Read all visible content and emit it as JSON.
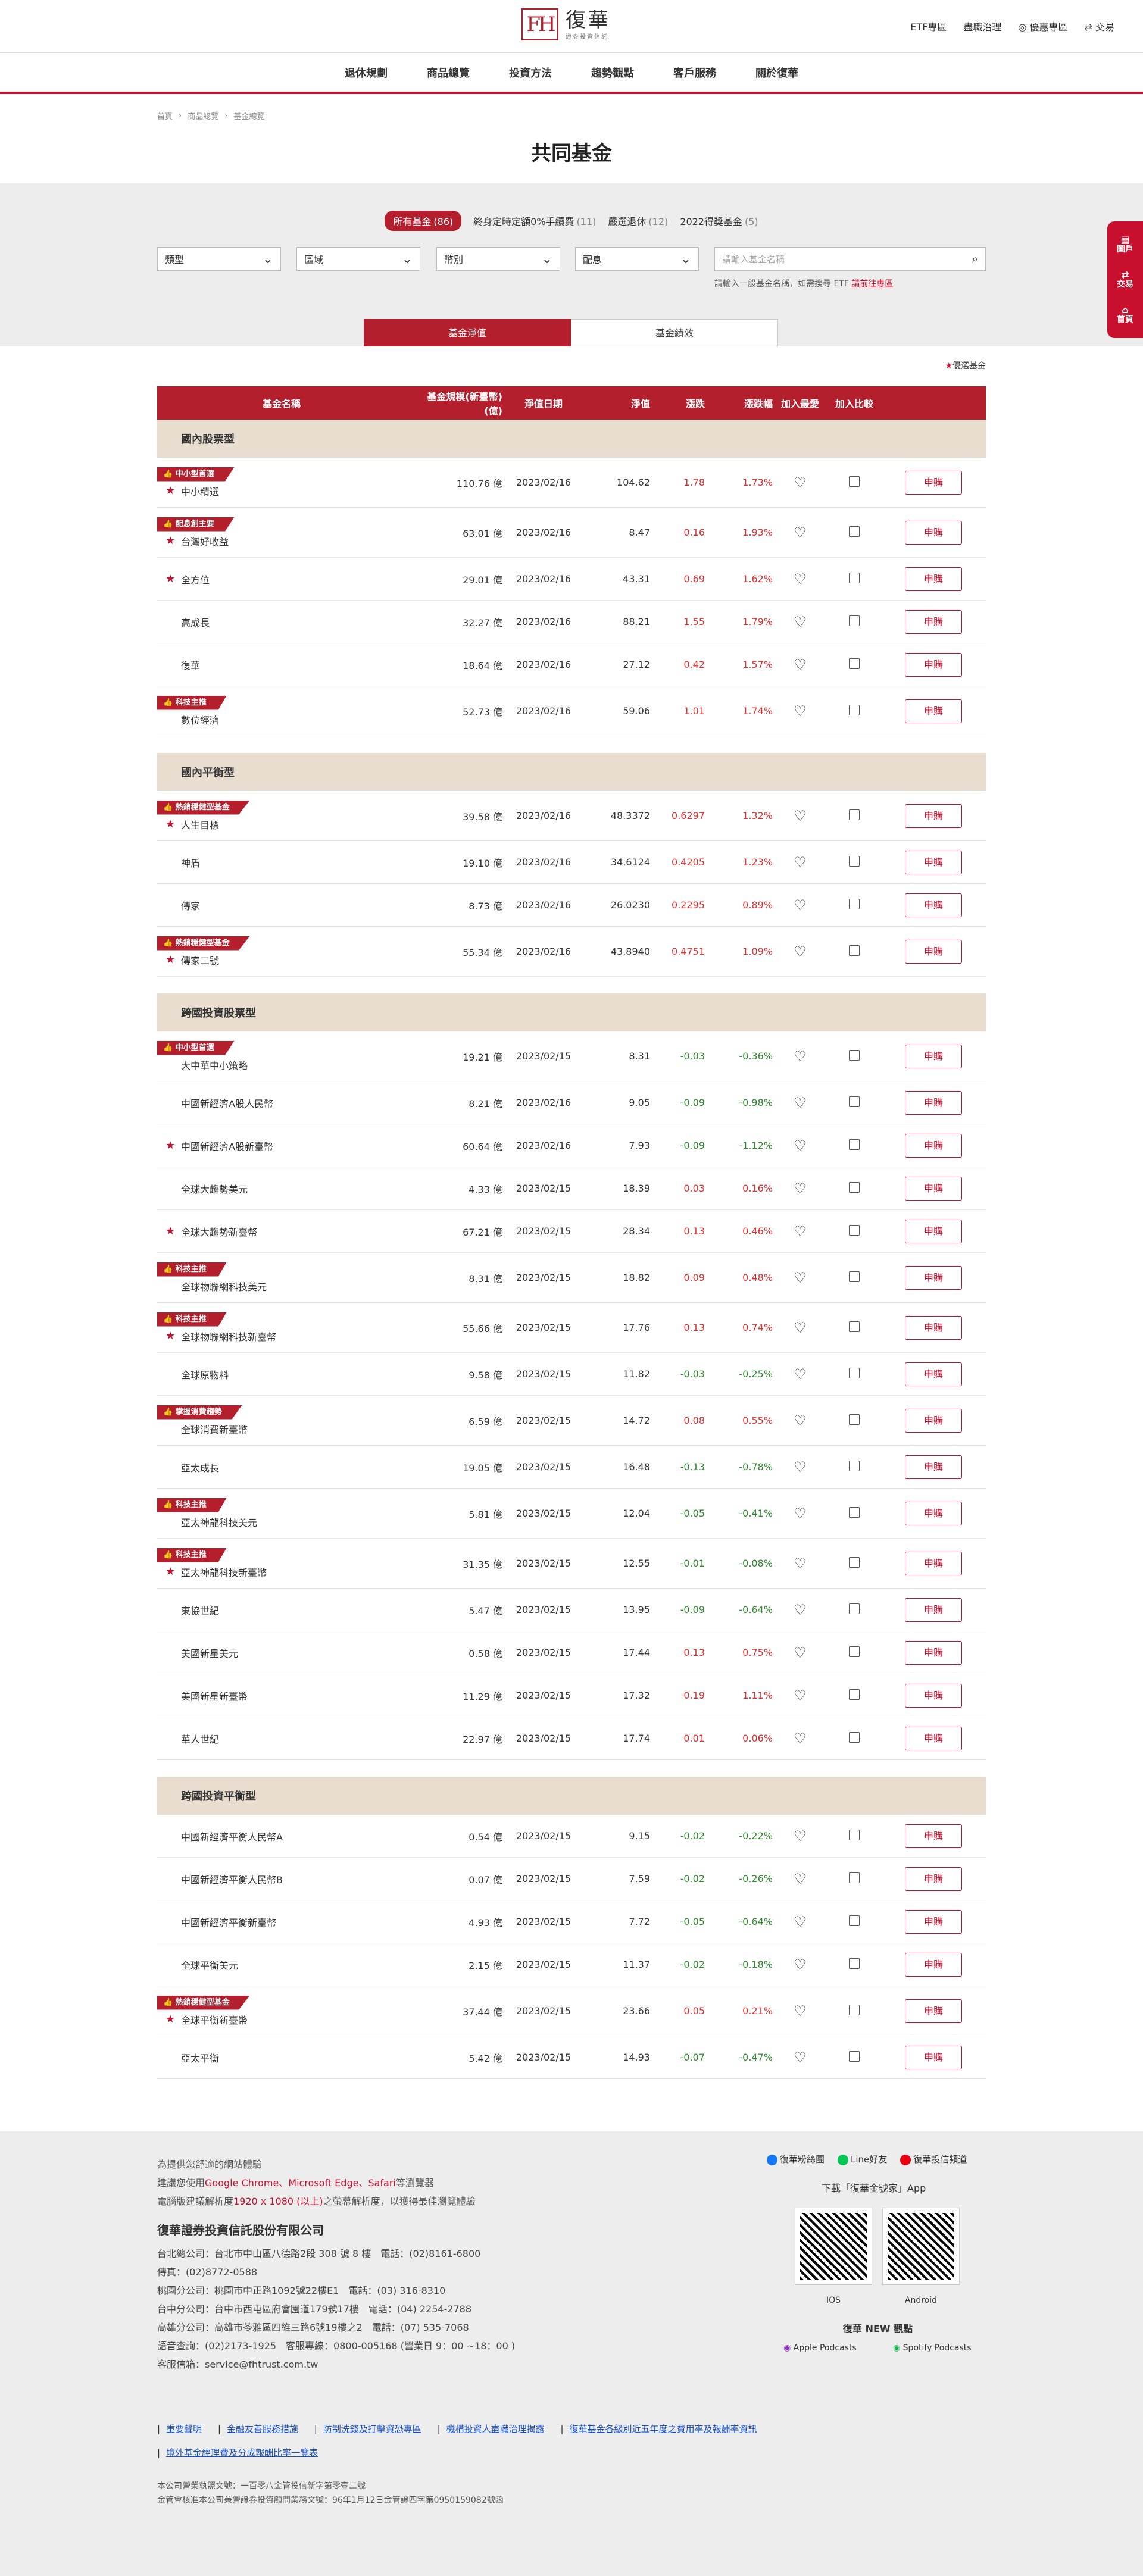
{
  "header": {
    "logo_mark": "FH",
    "logo_cn": "復華",
    "logo_sub": "證券投資信託",
    "links": [
      "ETF專區",
      "盡職治理",
      "優惠專區",
      "交易"
    ]
  },
  "nav": [
    "退休規劃",
    "商品總覽",
    "投資方法",
    "趨勢觀點",
    "客戶服務",
    "關於復華"
  ],
  "breadcrumb": [
    "首頁",
    "商品總覽",
    "基金總覽"
  ],
  "title": "共同基金",
  "filter_tabs": [
    {
      "label": "所有基金",
      "count": "(86)"
    },
    {
      "label": "終身定時定額0%手續費",
      "count": "(11)"
    },
    {
      "label": "嚴選退休",
      "count": "(12)"
    },
    {
      "label": "2022得獎基金",
      "count": "(5)"
    }
  ],
  "selects": [
    "類型",
    "區域",
    "幣別",
    "配息"
  ],
  "search": {
    "placeholder": "請輸入基金名稱",
    "hint": "請輸入一般基金名稱，如需搜尋 ETF",
    "hint_link": "請前往專區"
  },
  "segments": [
    "基金淨值",
    "基金績效"
  ],
  "legend": "優選基金",
  "columns": [
    "基金名稱",
    "基金規模(新臺幣) (億)",
    "淨值日期",
    "淨值",
    "漲跌",
    "漲跌幅",
    "加入最愛",
    "加入比較"
  ],
  "buy_label": "申購",
  "groups": [
    {
      "title": "國內股票型",
      "rows": [
        {
          "tag": "中小型首選",
          "star": true,
          "name": "中小精選",
          "size": "110.76 億",
          "date": "2023/02/16",
          "nav": "104.62",
          "chg": "1.78",
          "pct": "1.73%",
          "dir": "up"
        },
        {
          "tag": "配息創主要",
          "star": true,
          "name": "台灣好收益",
          "size": "63.01 億",
          "date": "2023/02/16",
          "nav": "8.47",
          "chg": "0.16",
          "pct": "1.93%",
          "dir": "up"
        },
        {
          "tag": "",
          "star": true,
          "name": "全方位",
          "size": "29.01 億",
          "date": "2023/02/16",
          "nav": "43.31",
          "chg": "0.69",
          "pct": "1.62%",
          "dir": "up"
        },
        {
          "tag": "",
          "star": false,
          "name": "高成長",
          "size": "32.27 億",
          "date": "2023/02/16",
          "nav": "88.21",
          "chg": "1.55",
          "pct": "1.79%",
          "dir": "up"
        },
        {
          "tag": "",
          "star": false,
          "name": "復華",
          "size": "18.64 億",
          "date": "2023/02/16",
          "nav": "27.12",
          "chg": "0.42",
          "pct": "1.57%",
          "dir": "up"
        },
        {
          "tag": "科技主推",
          "star": false,
          "name": "數位經濟",
          "size": "52.73 億",
          "date": "2023/02/16",
          "nav": "59.06",
          "chg": "1.01",
          "pct": "1.74%",
          "dir": "up"
        }
      ]
    },
    {
      "title": "國內平衡型",
      "rows": [
        {
          "tag": "熱銷穩健型基金",
          "star": true,
          "name": "人生目標",
          "size": "39.58 億",
          "date": "2023/02/16",
          "nav": "48.3372",
          "chg": "0.6297",
          "pct": "1.32%",
          "dir": "up"
        },
        {
          "tag": "",
          "star": false,
          "name": "神盾",
          "size": "19.10 億",
          "date": "2023/02/16",
          "nav": "34.6124",
          "chg": "0.4205",
          "pct": "1.23%",
          "dir": "up"
        },
        {
          "tag": "",
          "star": false,
          "name": "傳家",
          "size": "8.73 億",
          "date": "2023/02/16",
          "nav": "26.0230",
          "chg": "0.2295",
          "pct": "0.89%",
          "dir": "up"
        },
        {
          "tag": "熱銷穩健型基金",
          "star": true,
          "name": "傳家二號",
          "size": "55.34 億",
          "date": "2023/02/16",
          "nav": "43.8940",
          "chg": "0.4751",
          "pct": "1.09%",
          "dir": "up"
        }
      ]
    },
    {
      "title": "跨國投資股票型",
      "rows": [
        {
          "tag": "中小型首選",
          "star": false,
          "name": "大中華中小策略",
          "size": "19.21 億",
          "date": "2023/02/15",
          "nav": "8.31",
          "chg": "-0.03",
          "pct": "-0.36%",
          "dir": "dn"
        },
        {
          "tag": "",
          "star": false,
          "name": "中國新經濟A股人民幣",
          "size": "8.21 億",
          "date": "2023/02/16",
          "nav": "9.05",
          "chg": "-0.09",
          "pct": "-0.98%",
          "dir": "dn"
        },
        {
          "tag": "",
          "star": true,
          "name": "中國新經濟A股新臺幣",
          "size": "60.64 億",
          "date": "2023/02/16",
          "nav": "7.93",
          "chg": "-0.09",
          "pct": "-1.12%",
          "dir": "dn"
        },
        {
          "tag": "",
          "star": false,
          "name": "全球大趨勢美元",
          "size": "4.33 億",
          "date": "2023/02/15",
          "nav": "18.39",
          "chg": "0.03",
          "pct": "0.16%",
          "dir": "up"
        },
        {
          "tag": "",
          "star": true,
          "name": "全球大趨勢新臺幣",
          "size": "67.21 億",
          "date": "2023/02/15",
          "nav": "28.34",
          "chg": "0.13",
          "pct": "0.46%",
          "dir": "up"
        },
        {
          "tag": "科技主推",
          "star": false,
          "name": "全球物聯網科技美元",
          "size": "8.31 億",
          "date": "2023/02/15",
          "nav": "18.82",
          "chg": "0.09",
          "pct": "0.48%",
          "dir": "up"
        },
        {
          "tag": "科技主推",
          "star": true,
          "name": "全球物聯網科技新臺幣",
          "size": "55.66 億",
          "date": "2023/02/15",
          "nav": "17.76",
          "chg": "0.13",
          "pct": "0.74%",
          "dir": "up"
        },
        {
          "tag": "",
          "star": false,
          "name": "全球原物料",
          "size": "9.58 億",
          "date": "2023/02/15",
          "nav": "11.82",
          "chg": "-0.03",
          "pct": "-0.25%",
          "dir": "dn"
        },
        {
          "tag": "掌握消費趨勢",
          "star": false,
          "name": "全球消費新臺幣",
          "size": "6.59 億",
          "date": "2023/02/15",
          "nav": "14.72",
          "chg": "0.08",
          "pct": "0.55%",
          "dir": "up"
        },
        {
          "tag": "",
          "star": false,
          "name": "亞太成長",
          "size": "19.05 億",
          "date": "2023/02/15",
          "nav": "16.48",
          "chg": "-0.13",
          "pct": "-0.78%",
          "dir": "dn"
        },
        {
          "tag": "科技主推",
          "star": false,
          "name": "亞太神龍科技美元",
          "size": "5.81 億",
          "date": "2023/02/15",
          "nav": "12.04",
          "chg": "-0.05",
          "pct": "-0.41%",
          "dir": "dn"
        },
        {
          "tag": "科技主推",
          "star": true,
          "name": "亞太神龍科技新臺幣",
          "size": "31.35 億",
          "date": "2023/02/15",
          "nav": "12.55",
          "chg": "-0.01",
          "pct": "-0.08%",
          "dir": "dn"
        },
        {
          "tag": "",
          "star": false,
          "name": "東協世紀",
          "size": "5.47 億",
          "date": "2023/02/15",
          "nav": "13.95",
          "chg": "-0.09",
          "pct": "-0.64%",
          "dir": "dn"
        },
        {
          "tag": "",
          "star": false,
          "name": "美國新星美元",
          "size": "0.58 億",
          "date": "2023/02/15",
          "nav": "17.44",
          "chg": "0.13",
          "pct": "0.75%",
          "dir": "up"
        },
        {
          "tag": "",
          "star": false,
          "name": "美國新星新臺幣",
          "size": "11.29 億",
          "date": "2023/02/15",
          "nav": "17.32",
          "chg": "0.19",
          "pct": "1.11%",
          "dir": "up"
        },
        {
          "tag": "",
          "star": false,
          "name": "華人世紀",
          "size": "22.97 億",
          "date": "2023/02/15",
          "nav": "17.74",
          "chg": "0.01",
          "pct": "0.06%",
          "dir": "up"
        }
      ]
    },
    {
      "title": "跨國投資平衡型",
      "rows": [
        {
          "tag": "",
          "star": false,
          "name": "中國新經濟平衡人民幣A",
          "size": "0.54 億",
          "date": "2023/02/15",
          "nav": "9.15",
          "chg": "-0.02",
          "pct": "-0.22%",
          "dir": "dn"
        },
        {
          "tag": "",
          "star": false,
          "name": "中國新經濟平衡人民幣B",
          "size": "0.07 億",
          "date": "2023/02/15",
          "nav": "7.59",
          "chg": "-0.02",
          "pct": "-0.26%",
          "dir": "dn"
        },
        {
          "tag": "",
          "star": false,
          "name": "中國新經濟平衡新臺幣",
          "size": "4.93 億",
          "date": "2023/02/15",
          "nav": "7.72",
          "chg": "-0.05",
          "pct": "-0.64%",
          "dir": "dn"
        },
        {
          "tag": "",
          "star": false,
          "name": "全球平衡美元",
          "size": "2.15 億",
          "date": "2023/02/15",
          "nav": "11.37",
          "chg": "-0.02",
          "pct": "-0.18%",
          "dir": "dn"
        },
        {
          "tag": "熱銷穩健型基金",
          "star": true,
          "name": "全球平衡新臺幣",
          "size": "37.44 億",
          "date": "2023/02/15",
          "nav": "23.66",
          "chg": "0.05",
          "pct": "0.21%",
          "dir": "up"
        },
        {
          "tag": "",
          "star": false,
          "name": "亞太平衡",
          "size": "5.42 億",
          "date": "2023/02/15",
          "nav": "14.93",
          "chg": "-0.07",
          "pct": "-0.47%",
          "dir": "dn"
        }
      ]
    }
  ],
  "footer": {
    "browser1": "為提供您舒適的網站體驗",
    "browser2a": "建議您使用",
    "browser2b": "Google Chrome、Microsoft Edge、Safari",
    "browser2c": "等瀏覽器",
    "browser3a": "電腦版建議解析度",
    "browser3b": "1920 x 1080 (以上)",
    "browser3c": "之螢幕解析度，以獲得最佳瀏覽體驗",
    "company": "復華證券投資信託股份有限公司",
    "addr": [
      "台北總公司：台北市中山區八德路2段 308 號 8 樓　電話：(02)8161-6800",
      "傳真：(02)8772-0588",
      "桃園分公司：桃園市中正路1092號22樓E1　電話：(03) 316-8310",
      "台中分公司：台中市西屯區府會園道179號17樓　電話：(04) 2254-2788",
      "高雄分公司：高雄市苓雅區四維三路6號19樓之2　電話：(07) 535-7068",
      "語音查詢：(02)2173-1925　客服專線：0800-005168 (營業日 9：00 ~18：00 )",
      "客服信箱：service@fhtrust.com.tw"
    ],
    "social": [
      "復華粉絲團",
      "Line好友",
      "復華投信頻道"
    ],
    "app_title": "下載「復華金號家」App",
    "qr_labels": [
      "IOS",
      "Android"
    ],
    "podcast_title": "復華 NEW 觀點",
    "podcasts": [
      "Apple Podcasts",
      "Spotify Podcasts"
    ],
    "links": [
      "重要聲明",
      "金融友善服務措施",
      "防制洗錢及打擊資恐專區",
      "機構投資人盡職治理揭露",
      "復華基金各級別近五年度之費用率及報酬率資訊",
      "境外基金經理費及分成報酬比率一覽表"
    ],
    "license": [
      "本公司營業執照文號：一百零八金管投信新字第零壹二號",
      "金管會核准本公司兼營證券投資顧問業務文號：96年1月12日金管證四字第0950159082號函"
    ]
  },
  "side": [
    "圖戶",
    "交易",
    "首頁"
  ]
}
